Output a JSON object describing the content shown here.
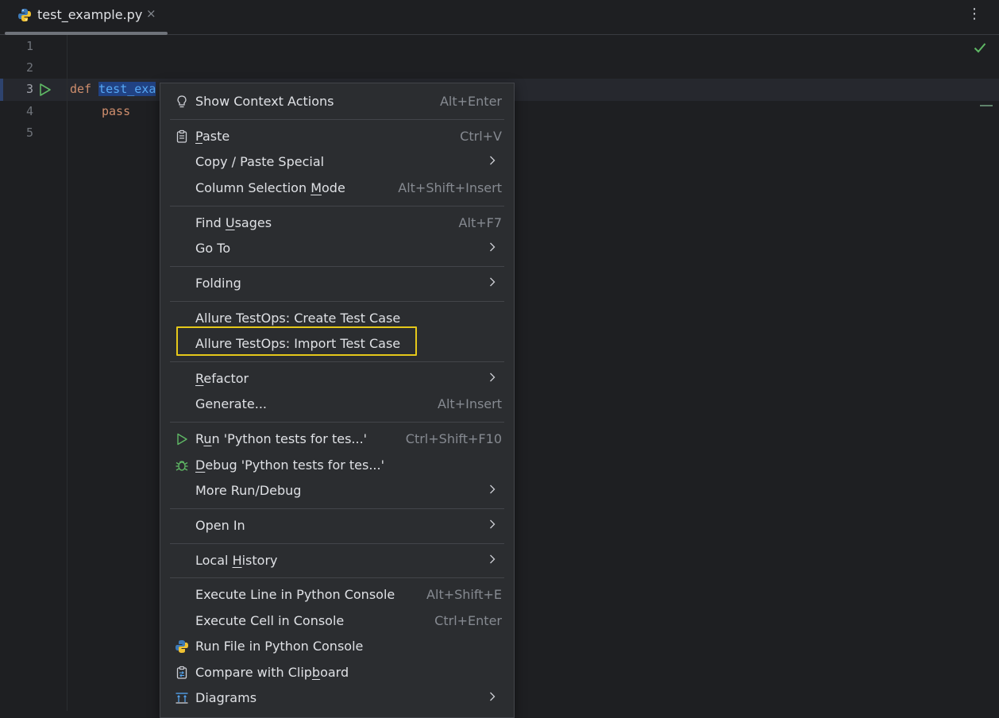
{
  "tab": {
    "filename": "test_example.py",
    "close": "×"
  },
  "editor": {
    "line_numbers": [
      "1",
      "2",
      "3",
      "4",
      "5"
    ],
    "code": {
      "def_kw": "def",
      "func_name": "test_exa",
      "pass_kw": "pass"
    }
  },
  "menu": {
    "show_context_actions": {
      "label": "Show Context Actions",
      "shortcut": "Alt+Enter"
    },
    "paste": {
      "label_u": "P",
      "label_rest": "aste",
      "shortcut": "Ctrl+V"
    },
    "copy_paste_special": {
      "label": "Copy / Paste Special"
    },
    "column_selection_mode": {
      "label_pre": "Column Selection ",
      "label_u": "M",
      "label_rest": "ode",
      "shortcut": "Alt+Shift+Insert"
    },
    "find_usages": {
      "label_pre": "Find ",
      "label_u": "U",
      "label_rest": "sages",
      "shortcut": "Alt+F7"
    },
    "go_to": {
      "label": "Go To"
    },
    "folding": {
      "label": "Folding"
    },
    "allure_create": {
      "label": "Allure TestOps: Create Test Case"
    },
    "allure_import": {
      "label": "Allure TestOps: Import Test Case"
    },
    "refactor": {
      "label_u": "R",
      "label_rest": "efactor"
    },
    "generate": {
      "label": "Generate...",
      "shortcut": "Alt+Insert"
    },
    "run": {
      "label_pre": "R",
      "label_u": "u",
      "label_rest": "n 'Python tests for tes...'",
      "shortcut": "Ctrl+Shift+F10"
    },
    "debug": {
      "label_u": "D",
      "label_rest": "ebug 'Python tests for tes...'"
    },
    "more_run_debug": {
      "label": "More Run/Debug"
    },
    "open_in": {
      "label": "Open In"
    },
    "local_history": {
      "label_pre": "Local ",
      "label_u": "H",
      "label_rest": "istory"
    },
    "execute_line": {
      "label": "Execute Line in Python Console",
      "shortcut": "Alt+Shift+E"
    },
    "execute_cell": {
      "label": "Execute Cell in Console",
      "shortcut": "Ctrl+Enter"
    },
    "run_file_console": {
      "label": "Run File in Python Console"
    },
    "compare_clipboard": {
      "label_pre": "Compare with Clip",
      "label_u": "b",
      "label_rest": "oard"
    },
    "diagrams": {
      "label": "Diagrams"
    }
  },
  "colors": {
    "highlight_box": "#e5c81a",
    "keyword": "#cf8e6d",
    "function": "#56a8f5",
    "run_green": "#5fb865"
  }
}
